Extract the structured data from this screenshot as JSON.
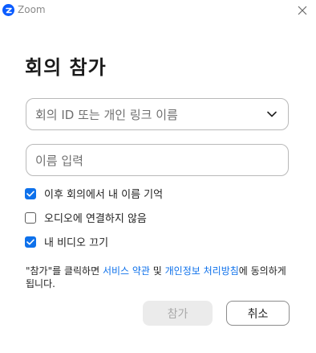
{
  "window": {
    "title": "Zoom",
    "logo_letter": "Z"
  },
  "dialog": {
    "heading": "회의 참가",
    "meeting_field": {
      "placeholder": "회의 ID 또는 개인 링크 이름",
      "value": ""
    },
    "name_field": {
      "placeholder": "이름 입력",
      "value": ""
    },
    "options": [
      {
        "label": "이후 회의에서 내 이름 기억",
        "checked": true
      },
      {
        "label": "오디오에 연결하지 않음",
        "checked": false
      },
      {
        "label": "내 비디오 끄기",
        "checked": true
      }
    ],
    "legal": {
      "prefix": "\"참가\"를 클릭하면 ",
      "terms_link": "서비스 약관",
      "and": " 및 ",
      "privacy_link": "개인정보 처리방침",
      "suffix": "에 동의하게 됩니다."
    },
    "buttons": {
      "join": "참가",
      "cancel": "취소"
    }
  },
  "colors": {
    "accent": "#0e71eb",
    "logo": "#0b5cff",
    "disabled_bg": "#ebebeb",
    "disabled_text": "#a9a9a9"
  }
}
